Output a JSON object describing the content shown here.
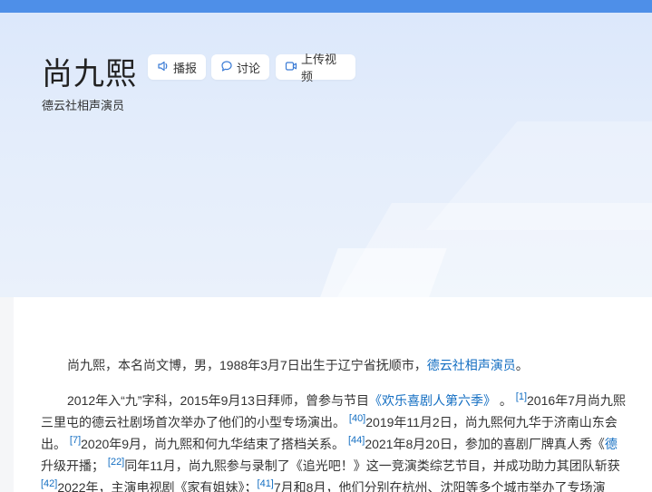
{
  "header": {
    "title": "尚九熙",
    "subtitle": "德云社相声演员",
    "actions": [
      {
        "label": "播报",
        "icon": "speaker-icon"
      },
      {
        "label": "讨论",
        "icon": "chat-bubble-icon"
      },
      {
        "label": "上传视频",
        "icon": "video-icon"
      }
    ]
  },
  "intro": {
    "text_before": "尚九熙，本名尚文博，男，1988年3月7日出生于辽宁省抚顺市，",
    "link": "德云社相声演员",
    "text_after": "。"
  },
  "body": {
    "l1_a": "2012年入“九”字科，2015年9月13日拜师，曾参与节目",
    "l1_link": "《欢乐喜剧人第六季》",
    "l1_b": " 。",
    "l1_ref": "[1]",
    "l1_c": "2016年7月尚九熙",
    "l2_a": "三里屯的德云社剧场首次举办了他们的小型专场演出。",
    "l2_ref": "[40]",
    "l2_b": "2019年11月2日，尚九熙何九华于济南山东会",
    "l3_a": "出。",
    "l3_ref1": "[7]",
    "l3_b": "2020年9月，尚九熙和何九华结束了搭档关系。",
    "l3_ref2": "[44]",
    "l3_c": "2021年8月20日，参加的喜剧厂牌真人秀《",
    "l3_link": "德",
    "l4_a": "升级开播；",
    "l4_ref": "[22]",
    "l4_b": "同年11月，尚九熙参与录制了《追光吧！》这一竞演类综艺节目，并成功助力其团队斩获",
    "l5_ref1": "[42]",
    "l5_a": "2022年，主演电视剧《家有姐妹》；",
    "l5_ref2": "[41]",
    "l5_b": "7月和8月，他们分别在杭州、沈阳等多个城市举办了专场演"
  },
  "colors": {
    "accent": "#4e8fe8",
    "link": "#136ec2"
  }
}
